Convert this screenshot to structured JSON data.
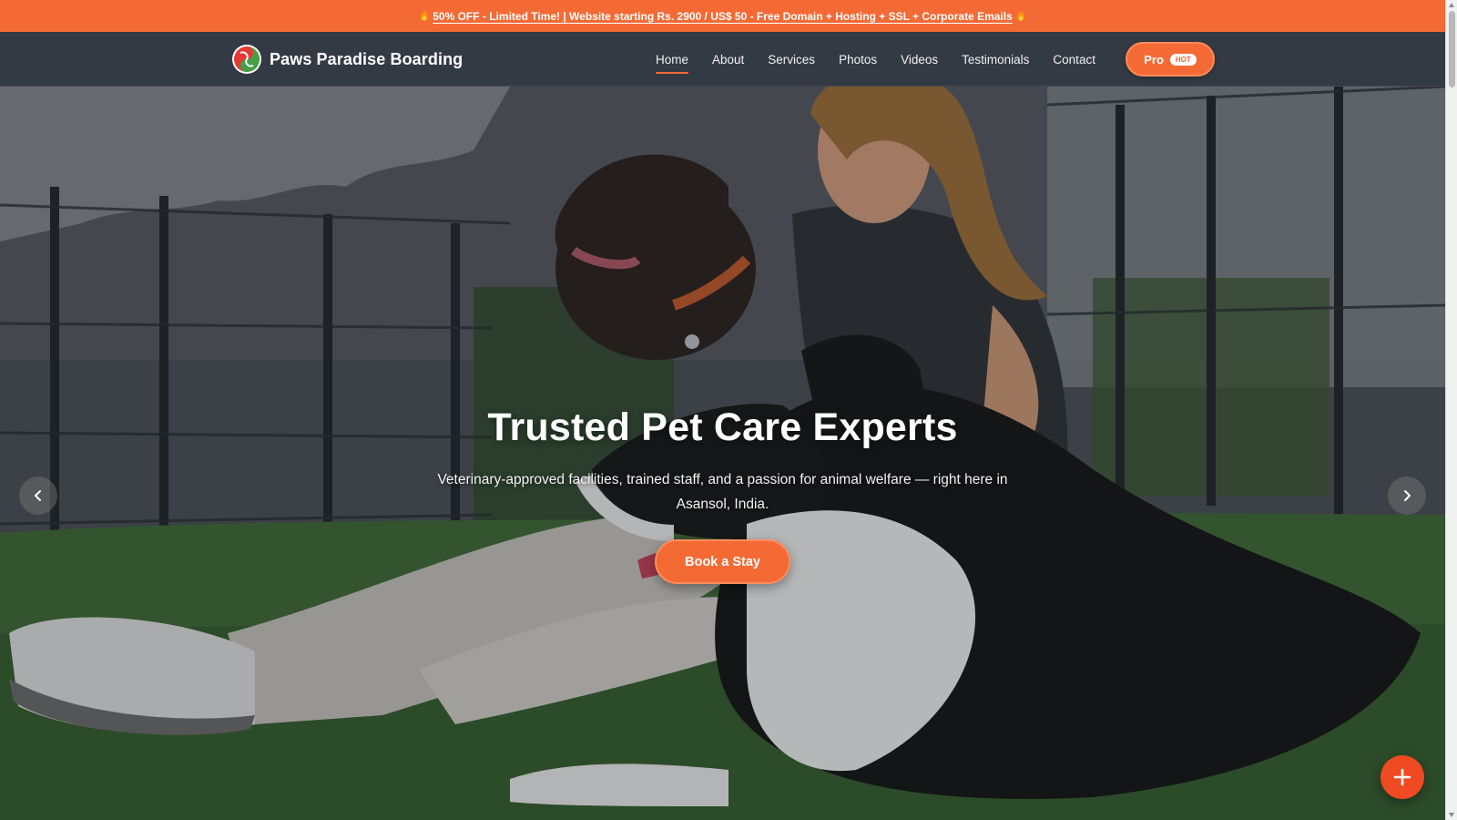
{
  "promo": {
    "text": "50% OFF - Limited Time! | Website starting Rs. 2900 / US$ 50 - Free Domain + Hosting + SSL + Corporate Emails",
    "icon": "flame-icon"
  },
  "brand": {
    "name": "Paws Paradise Boarding",
    "logo_colors": [
      "#e53935",
      "#43a047"
    ]
  },
  "nav": {
    "items": [
      {
        "label": "Home",
        "active": true
      },
      {
        "label": "About"
      },
      {
        "label": "Services"
      },
      {
        "label": "Photos"
      },
      {
        "label": "Videos"
      },
      {
        "label": "Testimonials"
      },
      {
        "label": "Contact"
      }
    ],
    "pro_label": "Pro",
    "hot_badge": "HOT"
  },
  "hero": {
    "title": "Trusted Pet Care Experts",
    "subtitle": "Veterinary-approved facilities, trained staff, and a passion for animal welfare — right here in Asansol, India.",
    "cta_label": "Book a Stay",
    "prev_icon": "chevron-left-icon",
    "next_icon": "chevron-right-icon"
  },
  "fab": {
    "icon": "plus-icon"
  },
  "colors": {
    "accent": "#f46a35",
    "nav_bg": "#343a44",
    "fab": "#f04a22"
  }
}
